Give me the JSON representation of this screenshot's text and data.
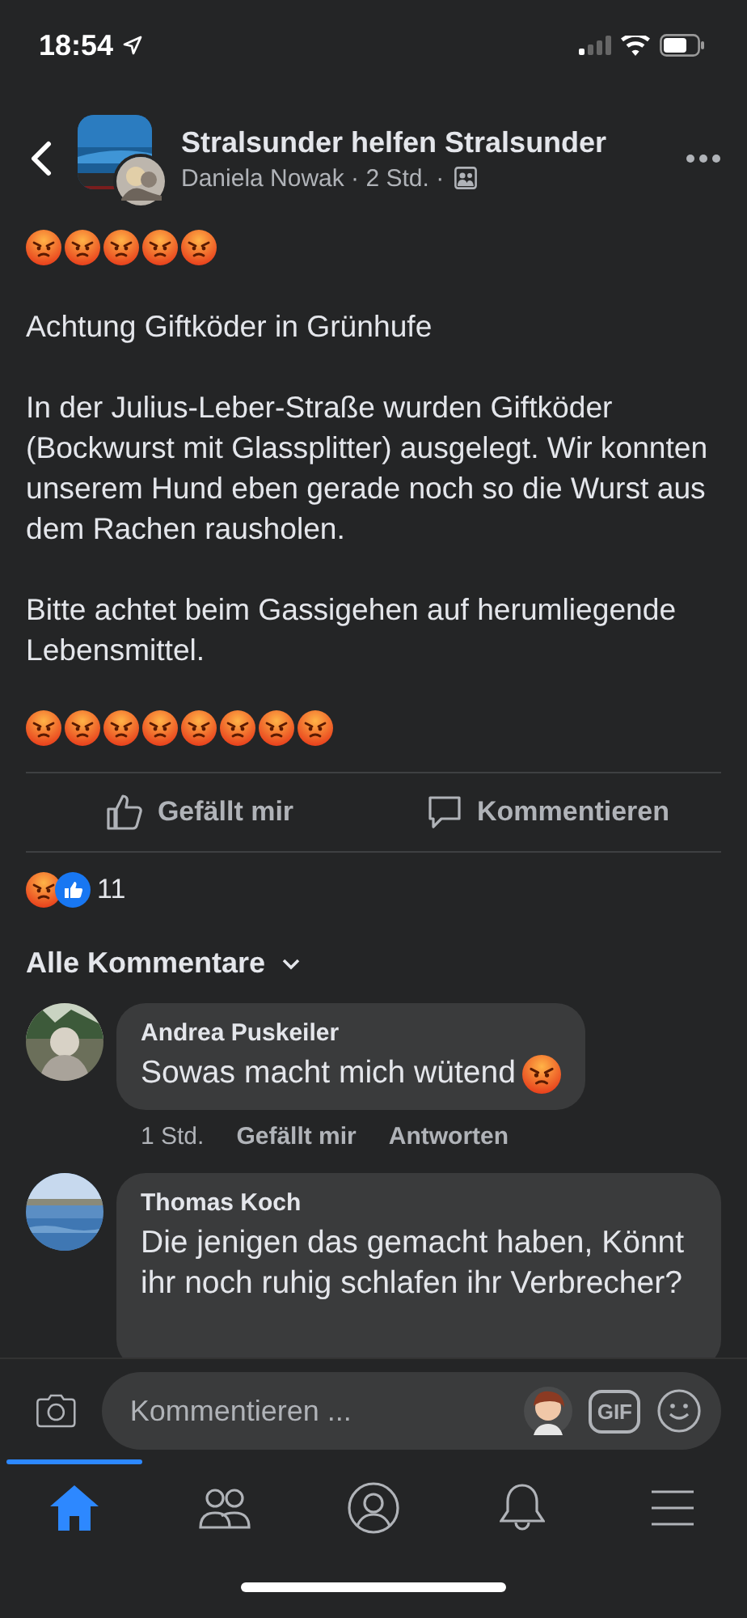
{
  "status_bar": {
    "time": "18:54"
  },
  "header": {
    "title": "Stralsunder helfen Stralsunder",
    "subtitle": "Daniela Nowak · 2 Std. ·"
  },
  "post": {
    "blocks": [
      {
        "kind": "emoji_row",
        "emojis": [
          {
            "kind": "angry"
          },
          {
            "kind": "angry"
          },
          {
            "kind": "angry"
          },
          {
            "kind": "angry"
          },
          {
            "kind": "angry"
          }
        ]
      },
      {
        "kind": "text",
        "text": "Achtung Giftköder in Grünhufe"
      },
      {
        "kind": "text",
        "text": "In der Julius-Leber-Straße wurden Giftköder (Bockwurst mit Glassplitter) ausgelegt. Wir konnten unserem Hund eben gerade noch so die Wurst aus dem Rachen rausholen."
      },
      {
        "kind": "text",
        "text": "Bitte achtet beim Gassigehen auf herumliegende Lebensmittel."
      },
      {
        "kind": "emoji_row",
        "emojis": [
          {
            "kind": "angry"
          },
          {
            "kind": "angry"
          },
          {
            "kind": "angry"
          },
          {
            "kind": "angry"
          },
          {
            "kind": "angry"
          },
          {
            "kind": "angry"
          },
          {
            "kind": "angry"
          },
          {
            "kind": "angry"
          }
        ]
      }
    ]
  },
  "actions": [
    {
      "kind": "like",
      "label": "Gefällt mir"
    },
    {
      "kind": "comment",
      "label": "Kommentieren"
    }
  ],
  "reactions": {
    "icons": [
      {
        "kind": "angry"
      },
      {
        "kind": "like"
      }
    ],
    "count": "11"
  },
  "comments_filter": {
    "label": "Alle Kommentare"
  },
  "comments": [
    {
      "author": "Andrea Puskeiler",
      "text": "Sowas macht mich wütend",
      "emojis": [
        {
          "kind": "angry"
        }
      ],
      "time": "1 Std.",
      "like": "Gefällt mir",
      "reply": "Antworten"
    },
    {
      "author": "Thomas Koch",
      "text": "Die jenigen das gemacht haben, Könnt ihr noch ruhig schlafen ihr Verbrecher?"
    }
  ],
  "composer": {
    "placeholder": "Kommentieren ...",
    "gif": "GIF"
  },
  "nav": {
    "tabs": [
      {
        "kind": "home",
        "selected": true
      },
      {
        "kind": "friends",
        "selected": false
      },
      {
        "kind": "profile",
        "selected": false
      },
      {
        "kind": "notifications",
        "selected": false
      },
      {
        "kind": "menu",
        "selected": false
      }
    ]
  }
}
